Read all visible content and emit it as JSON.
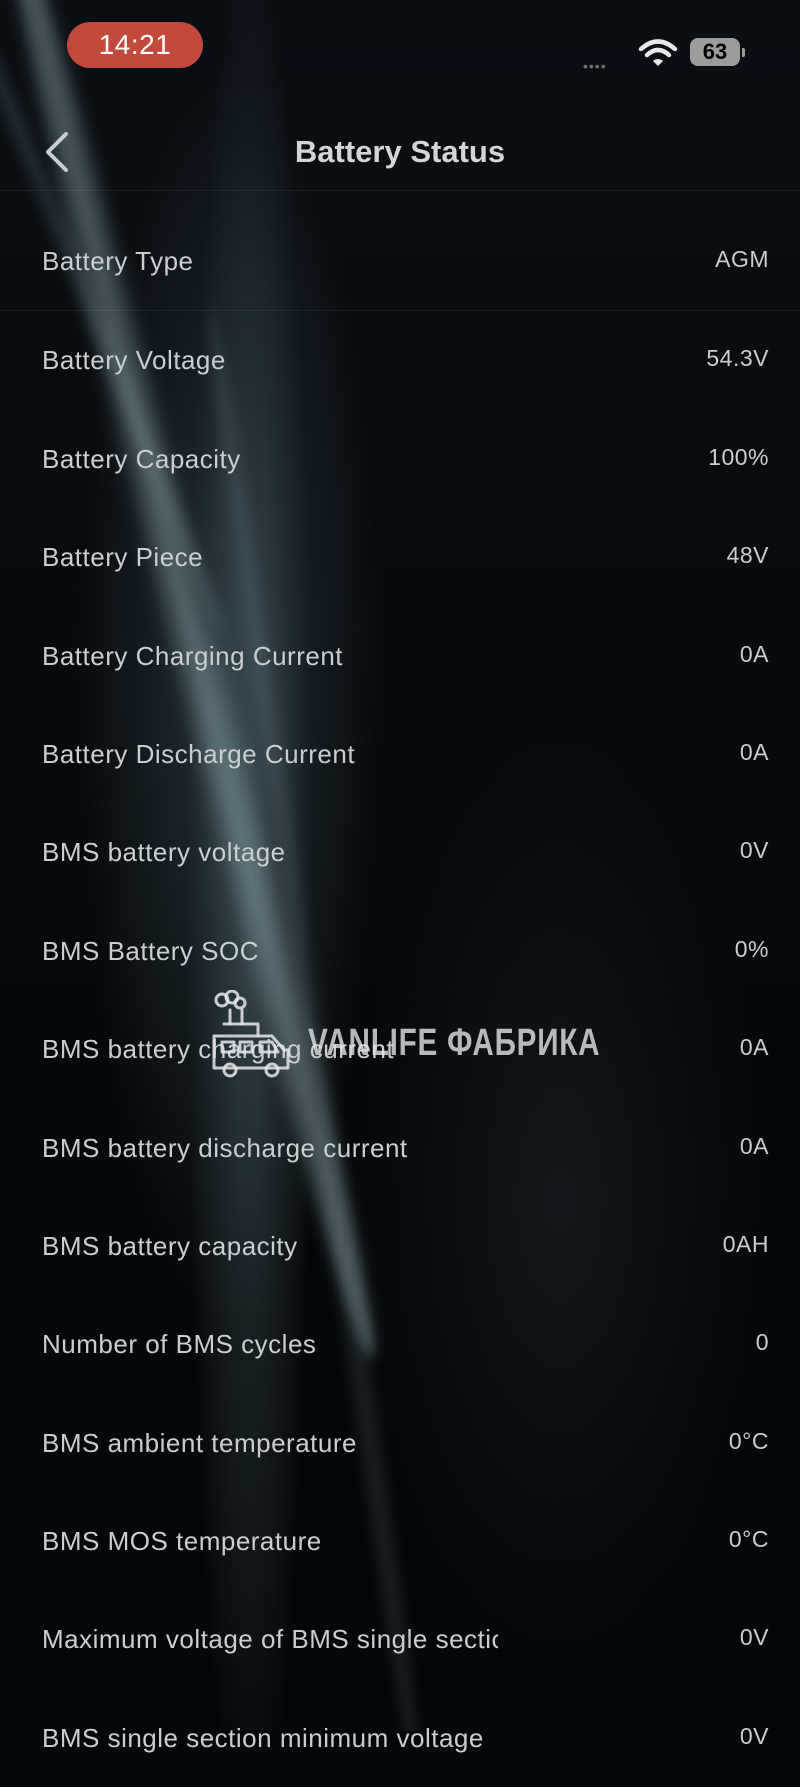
{
  "status_bar": {
    "time": "14:21",
    "battery_level": "63",
    "signal_indicator": "••••"
  },
  "header": {
    "title": "Battery Status",
    "back_icon": "chevron-left-icon"
  },
  "rows": [
    {
      "label": "Battery Type",
      "value": "AGM"
    },
    {
      "label": "Battery Voltage",
      "value": "54.3V"
    },
    {
      "label": "Battery Capacity",
      "value": "100%"
    },
    {
      "label": "Battery Piece",
      "value": "48V"
    },
    {
      "label": "Battery Charging Current",
      "value": "0A"
    },
    {
      "label": "Battery Discharge Current",
      "value": "0A"
    },
    {
      "label": "BMS battery voltage",
      "value": "0V"
    },
    {
      "label": "BMS Battery SOC",
      "value": "0%"
    },
    {
      "label": "BMS battery charging current",
      "value": "0A"
    },
    {
      "label": "BMS battery discharge current",
      "value": "0A"
    },
    {
      "label": "BMS battery capacity",
      "value": "0AH"
    },
    {
      "label": "Number of BMS cycles",
      "value": "0"
    },
    {
      "label": "BMS ambient temperature",
      "value": "0°C"
    },
    {
      "label": "BMS MOS temperature",
      "value": "0°C"
    },
    {
      "label": "Maximum voltage of BMS single section",
      "value": "0V"
    },
    {
      "label": "BMS single section minimum voltage",
      "value": "0V"
    }
  ],
  "watermark": {
    "text": "VANLIFE ФАБРИКА",
    "icon": "factory-van-icon"
  },
  "colors": {
    "background": "#05080b",
    "time_pill": "#c24a3d",
    "text": "#c9ced3"
  }
}
